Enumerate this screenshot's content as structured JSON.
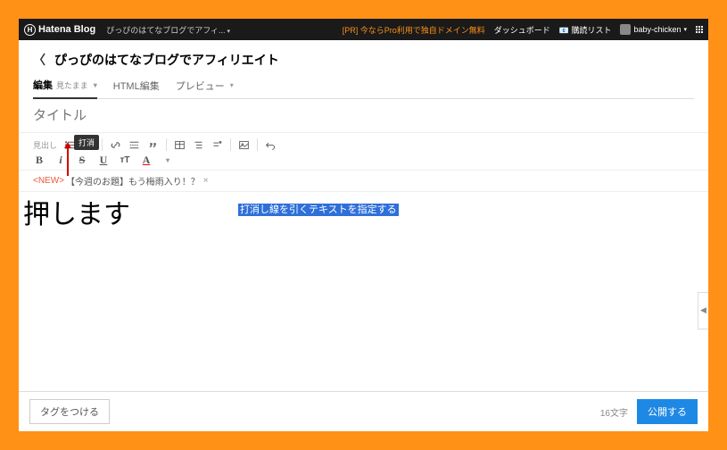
{
  "topbar": {
    "logo": "Hatena Blog",
    "subtitle": "ぴっぴのはてなブログでアフィ...",
    "pr": "[PR] 今ならPro利用で独自ドメイン無料",
    "dashboard": "ダッシュボード",
    "deliverylist": "購読リスト",
    "username": "baby-chicken"
  },
  "header": {
    "title": "ぴっぴのはてなブログでアフィリエイト"
  },
  "tabs": {
    "edit": "編集",
    "edit_sub": "見たまま",
    "html": "HTML編集",
    "preview": "プレビュー"
  },
  "title_placeholder": "タイトル",
  "toolbar": {
    "heading": "見出し",
    "strike_tooltip": "打消"
  },
  "newbar": {
    "tag": "<NEW>",
    "text": "【今週のお題】もう梅雨入り！？",
    "close": "×"
  },
  "editor": {
    "selected": "打消し線を引くテキストを指定する"
  },
  "footer": {
    "tag_button": "タグをつける",
    "char_count": "16文字",
    "publish": "公開する"
  },
  "annotation": "押します"
}
